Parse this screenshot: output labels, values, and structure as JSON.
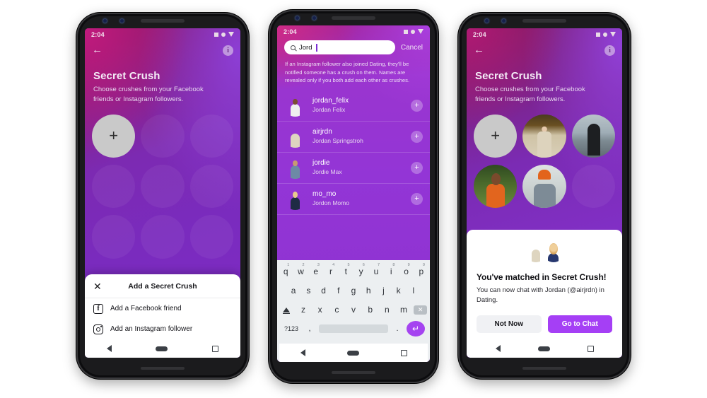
{
  "meta": {
    "status_time": "2:04",
    "accent_purple": "#a53ff5",
    "sheet_bg": "#ffffff"
  },
  "phone1": {
    "status": {
      "time": "2:04",
      "icons": [
        "wifi-square-icon",
        "signal-circle-icon",
        "battery-triangle-icon"
      ]
    },
    "nav": {
      "back": "←",
      "info": "i"
    },
    "header": {
      "title": "Secret Crush",
      "subtitle": "Choose crushes from your Facebook friends or Instagram followers."
    },
    "grid": {
      "add_label": "+",
      "cells": [
        "add",
        "empty",
        "empty",
        "empty",
        "empty",
        "empty",
        "empty",
        "empty",
        "empty"
      ]
    },
    "sheet": {
      "close": "✕",
      "title": "Add a Secret Crush",
      "options": [
        {
          "icon": "facebook-icon",
          "glyph": "f",
          "label": "Add a Facebook friend"
        },
        {
          "icon": "instagram-icon",
          "glyph": "",
          "label": "Add an Instagram follower"
        }
      ]
    },
    "android_nav": {
      "back": "back-triangle",
      "home": "home-pill",
      "recents": "recents-square"
    }
  },
  "phone2": {
    "status": {
      "time": "2:04",
      "icons": [
        "wifi-square-icon",
        "signal-circle-icon",
        "battery-triangle-icon"
      ]
    },
    "search": {
      "value": "Jord",
      "placeholder": "Search",
      "icon": "search-icon",
      "cancel_label": "Cancel"
    },
    "blurb": "If an Instagram follower also joined Dating, they'll be notified someone has a crush on them. Names are revealed only if you both add each other as crushes.",
    "results": [
      {
        "handle": "jordan_felix",
        "name": "Jordan Felix",
        "add": "+",
        "photo": "ph-jordan"
      },
      {
        "handle": "airjrdn",
        "name": "Jordan Springstroh",
        "add": "+",
        "photo": "ph-airjrdn"
      },
      {
        "handle": "jordie",
        "name": "Jordie Max",
        "add": "+",
        "photo": "ph-jordie"
      },
      {
        "handle": "mo_mo",
        "name": "Jordon Momo",
        "add": "+",
        "photo": "ph-momo"
      }
    ],
    "keyboard": {
      "row1": [
        {
          "k": "q",
          "n": "1"
        },
        {
          "k": "w",
          "n": "2"
        },
        {
          "k": "e",
          "n": "3"
        },
        {
          "k": "r",
          "n": "4"
        },
        {
          "k": "t",
          "n": "5"
        },
        {
          "k": "y",
          "n": "6"
        },
        {
          "k": "u",
          "n": "7"
        },
        {
          "k": "i",
          "n": "8"
        },
        {
          "k": "o",
          "n": "9"
        },
        {
          "k": "p",
          "n": "0"
        }
      ],
      "row2": [
        "a",
        "s",
        "d",
        "f",
        "g",
        "h",
        "j",
        "k",
        "l"
      ],
      "row3": [
        "z",
        "x",
        "c",
        "v",
        "b",
        "n",
        "m"
      ],
      "shift_label": "shift-key",
      "backspace_label": "✕",
      "symbols_label": "?123",
      "comma_label": ",",
      "period_label": ".",
      "space_label": "",
      "enter_label": "↵"
    },
    "android_nav": {
      "back": "back-triangle",
      "home": "home-pill",
      "recents": "recents-square"
    }
  },
  "phone3": {
    "status": {
      "time": "2:04",
      "icons": [
        "wifi-square-icon",
        "signal-circle-icon",
        "battery-triangle-icon"
      ]
    },
    "nav": {
      "back": "←",
      "info": "i"
    },
    "header": {
      "title": "Secret Crush",
      "subtitle": "Choose crushes from your Facebook friends or Instagram followers."
    },
    "grid": {
      "add_label": "+",
      "cells": [
        {
          "type": "add",
          "photo": ""
        },
        {
          "type": "photo",
          "photo": "ph-beard"
        },
        {
          "type": "photo",
          "photo": "ph-black"
        },
        {
          "type": "photo",
          "photo": "ph-orange"
        },
        {
          "type": "photo",
          "photo": "ph-beanie"
        },
        {
          "type": "empty",
          "photo": ""
        }
      ]
    },
    "match": {
      "avatars": [
        "ph-airjrdn",
        "ph-blonde"
      ],
      "title": "You've matched in Secret Crush!",
      "body": "You can now chat with Jordan (@airjrdn) in Dating.",
      "secondary_label": "Not Now",
      "primary_label": "Go to Chat"
    },
    "android_nav": {
      "back": "back-triangle",
      "home": "home-pill",
      "recents": "recents-square"
    }
  }
}
